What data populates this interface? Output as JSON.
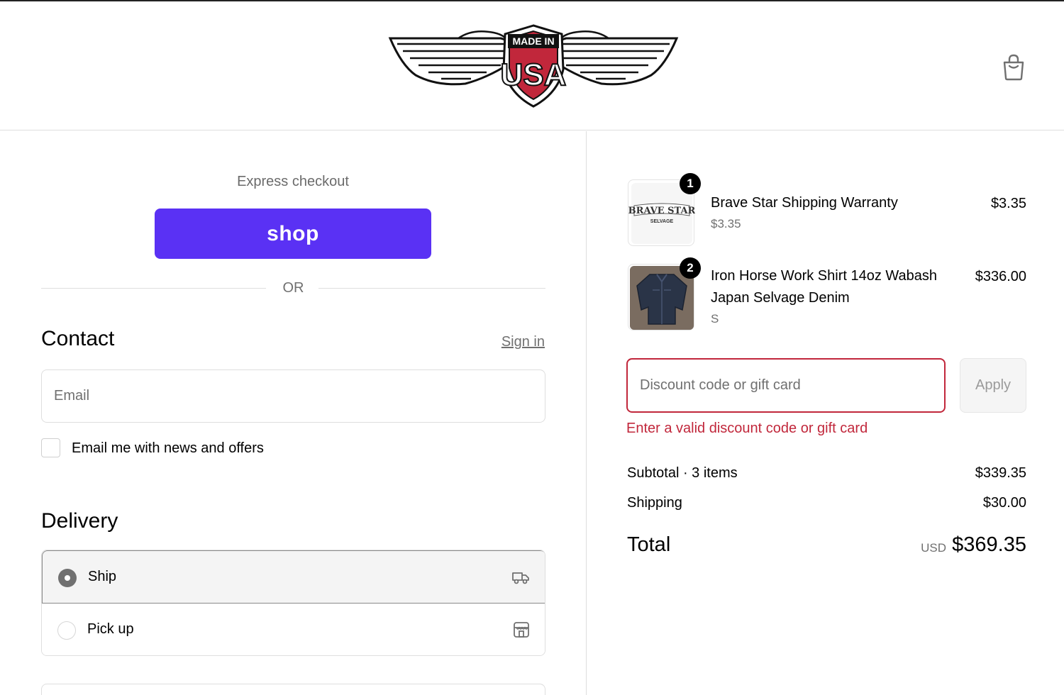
{
  "brand": {
    "logo_top": "MADE IN",
    "logo_main": "USA",
    "accent_red": "#c1273b",
    "shop_color": "#5a31f4"
  },
  "header": {
    "cart_icon": "shopping-bag-icon"
  },
  "express": {
    "title": "Express checkout",
    "shop_label": "shop",
    "or_label": "OR"
  },
  "contact": {
    "heading": "Contact",
    "signin_label": "Sign in",
    "email_placeholder": "Email",
    "newsletter_label": "Email me with news and offers",
    "newsletter_checked": false
  },
  "delivery": {
    "heading": "Delivery",
    "options": [
      {
        "label": "Ship",
        "selected": true,
        "icon": "truck-icon"
      },
      {
        "label": "Pick up",
        "selected": false,
        "icon": "store-icon"
      }
    ]
  },
  "cart": {
    "items": [
      {
        "qty": "1",
        "name": "Brave Star Shipping Warranty",
        "sub": "$3.35",
        "price": "$3.35",
        "thumb_text": "BRAVE STAR",
        "thumb_sub": "SELVAGE"
      },
      {
        "qty": "2",
        "name_line1": "Iron Horse Work Shirt 14oz Wabash",
        "name_line2": "Japan Selvage Denim",
        "sub": "S",
        "price": "$336.00"
      }
    ],
    "discount": {
      "placeholder": "Discount code or gift card",
      "apply_label": "Apply",
      "error": "Enter a valid discount code or gift card"
    },
    "summary": {
      "subtotal_label": "Subtotal · 3 items",
      "subtotal_value": "$339.35",
      "shipping_label": "Shipping",
      "shipping_value": "$30.00",
      "total_label": "Total",
      "currency": "USD",
      "total_value": "$369.35"
    }
  }
}
